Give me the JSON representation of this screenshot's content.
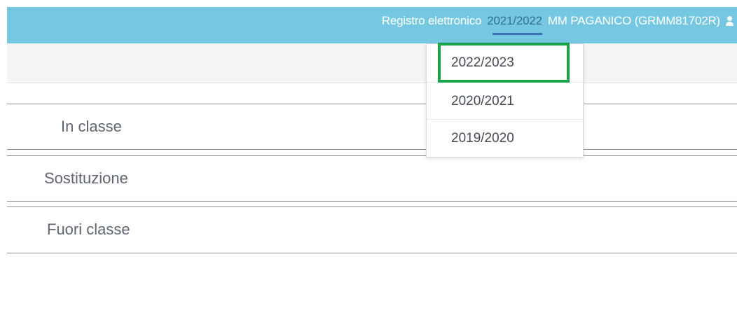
{
  "topbar": {
    "app_label": "Registro elettronico",
    "current_year": "2021/2022",
    "school": "MM PAGANICO (GRMM81702R)",
    "user_icon": "user-icon",
    "background": "#76c8e2"
  },
  "year_menu": {
    "items": [
      {
        "label": "2022/2023",
        "highlighted": true
      },
      {
        "label": "2020/2021",
        "highlighted": false
      },
      {
        "label": "2019/2020",
        "highlighted": false
      }
    ],
    "highlight_color": "#19a44b"
  },
  "sections": [
    {
      "label": "In classe"
    },
    {
      "label": "Sostituzione"
    },
    {
      "label": "Fuori classe"
    }
  ]
}
